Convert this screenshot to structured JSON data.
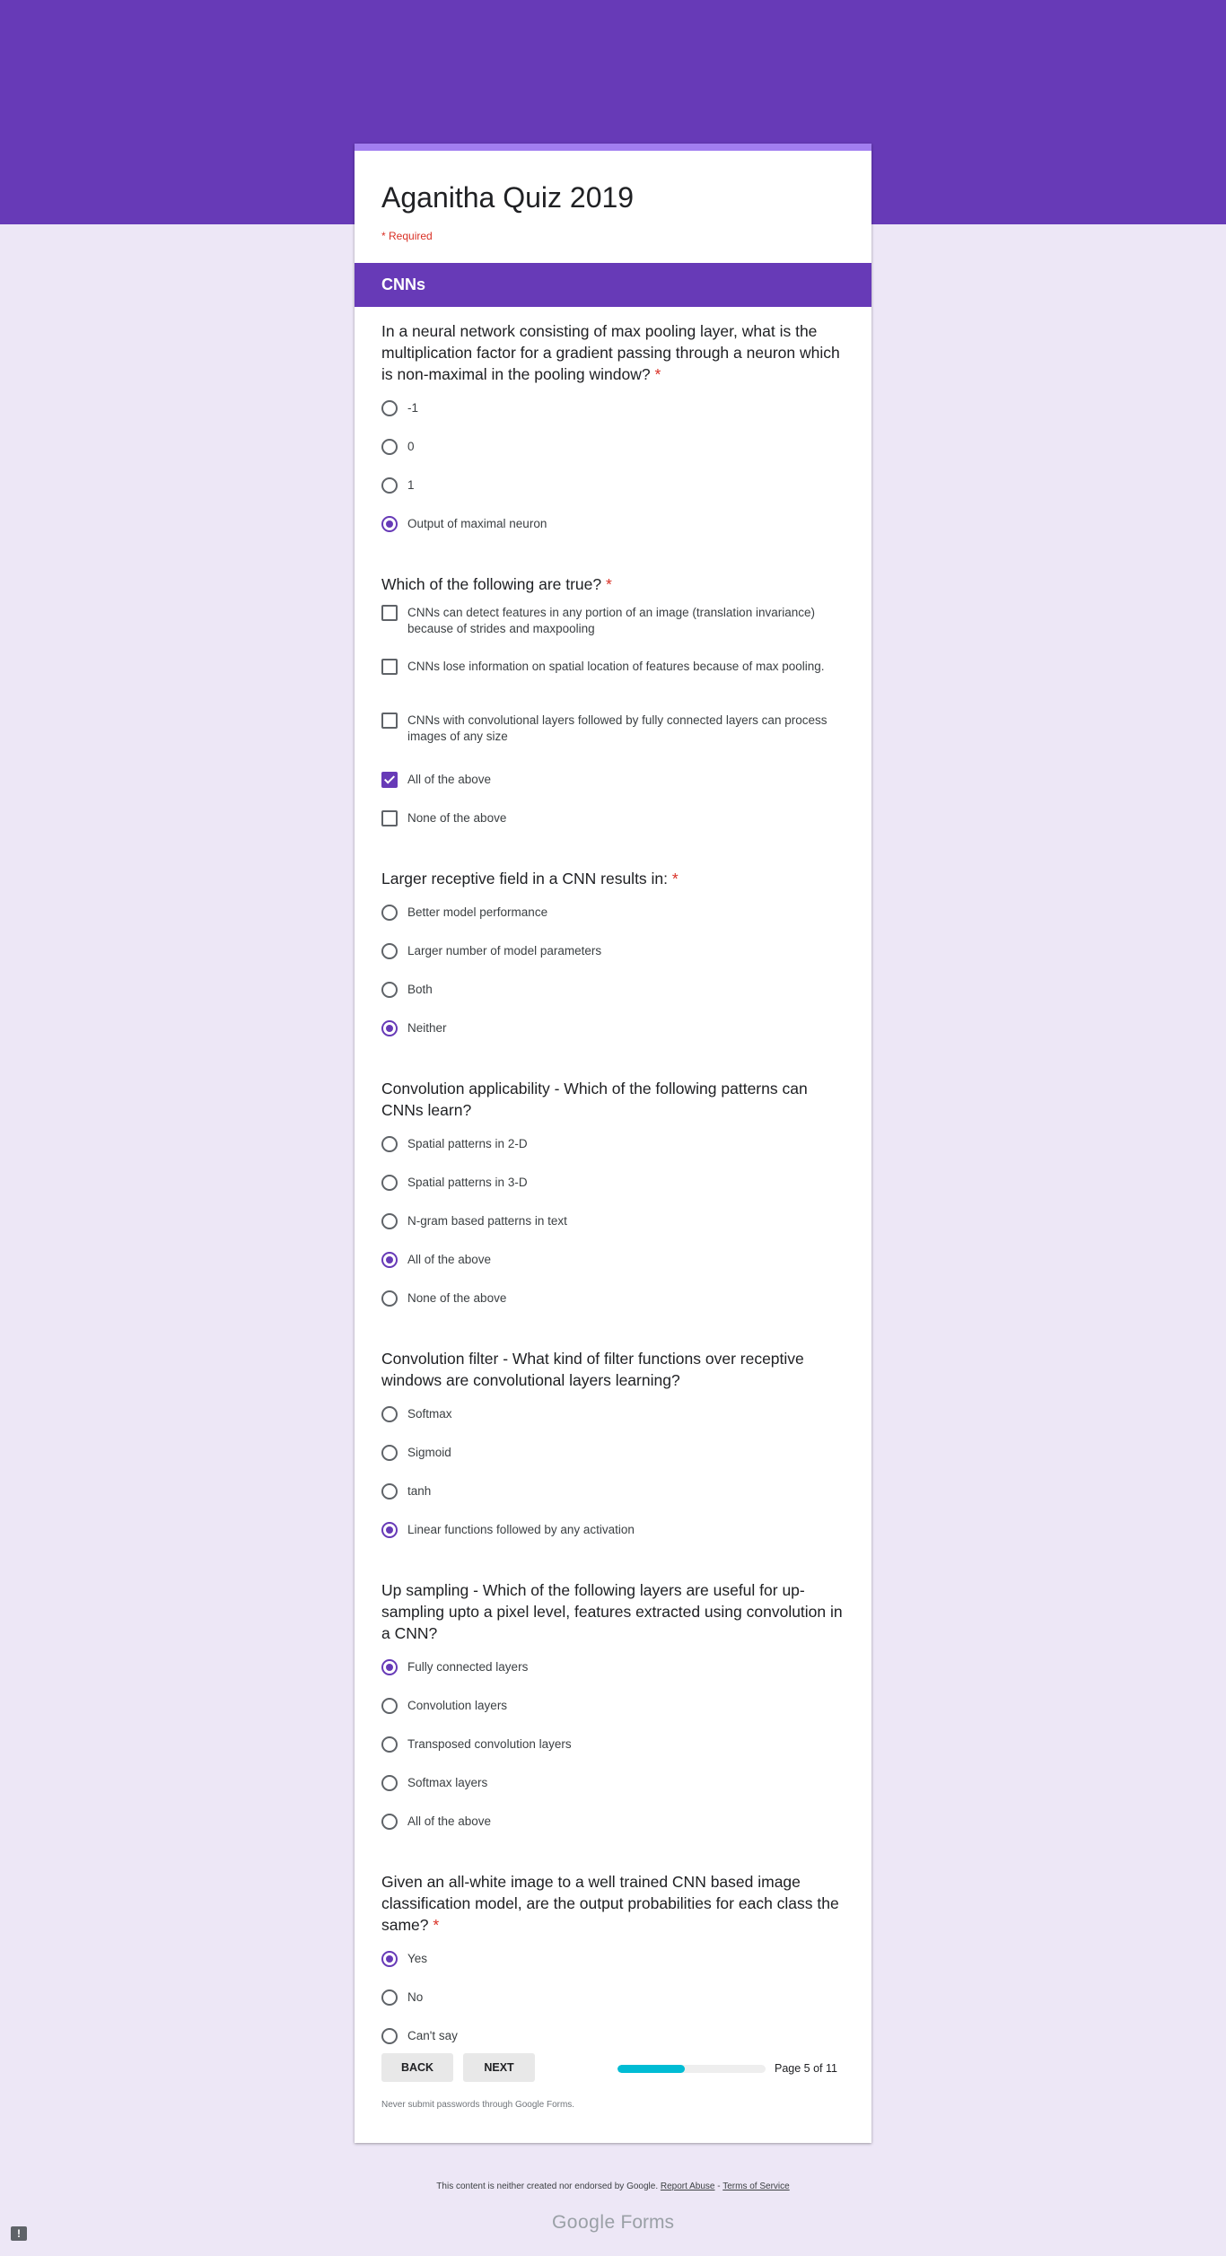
{
  "form": {
    "title": "Aganitha Quiz 2019",
    "required_note": "* Required",
    "section_title": "CNNs"
  },
  "questions": [
    {
      "title": "In a neural network consisting of max pooling layer, what is the multiplication factor for a gradient passing through a neuron which is non-maximal in the pooling window?",
      "required": true,
      "type": "radio",
      "options": [
        "-1",
        "0",
        "1",
        "Output of maximal neuron"
      ],
      "selected": [
        3
      ]
    },
    {
      "title": "Which of the following are true?",
      "required": true,
      "type": "checkbox",
      "options": [
        "CNNs can detect features in any portion of an image (translation invariance) because of strides and maxpooling",
        "CNNs lose information on spatial location of features because of max pooling.",
        "CNNs with convolutional layers followed by fully connected layers can process images of any size",
        "All of the above",
        "None of the above"
      ],
      "selected": [
        3
      ]
    },
    {
      "title": "Larger receptive field in a CNN results in:",
      "required": true,
      "type": "radio",
      "options": [
        "Better model performance",
        "Larger number of model parameters",
        "Both",
        "Neither"
      ],
      "selected": [
        3
      ]
    },
    {
      "title": "Convolution applicability - Which of the following patterns can CNNs learn?",
      "required": false,
      "type": "radio",
      "options": [
        "Spatial patterns in 2-D",
        "Spatial patterns in 3-D",
        "N-gram based patterns in text",
        "All of the above",
        "None of the above"
      ],
      "selected": [
        3
      ]
    },
    {
      "title": "Convolution filter - What kind of filter functions over receptive windows are convolutional layers learning?",
      "required": false,
      "type": "radio",
      "options": [
        "Softmax",
        "Sigmoid",
        "tanh",
        "Linear functions followed by any activation"
      ],
      "selected": [
        3
      ]
    },
    {
      "title": "Up sampling - Which of the following layers are useful for up-sampling upto a pixel level, features extracted using convolution in a CNN?",
      "required": false,
      "type": "radio",
      "options": [
        "Fully connected layers",
        "Convolution layers",
        "Transposed convolution layers",
        "Softmax layers",
        "All of the above"
      ],
      "selected": [
        0
      ]
    },
    {
      "title": "Given an all-white image to a well trained CNN based image classification model, are the output probabilities for each class the same?",
      "required": true,
      "type": "radio",
      "options": [
        "Yes",
        "No",
        "Can't say"
      ],
      "selected": [
        0
      ]
    }
  ],
  "navigation": {
    "back_label": "BACK",
    "next_label": "NEXT",
    "page_text": "Page 5 of 11",
    "progress_fraction": 0.4545
  },
  "footer": {
    "never_submit": "Never submit passwords through Google Forms.",
    "disclaimer_text": "This content is neither created nor endorsed by Google.",
    "report_abuse": "Report Abuse",
    "separator": " - ",
    "terms": "Terms of Service",
    "brand_google": "Google",
    "brand_forms": "Forms"
  },
  "colors": {
    "accent": "#673ab7",
    "banner": "#673ab7",
    "background": "#ede7f6",
    "required": "#d93025",
    "progress": "#00bcd4"
  },
  "icons": {
    "report": "report-problem-icon"
  }
}
